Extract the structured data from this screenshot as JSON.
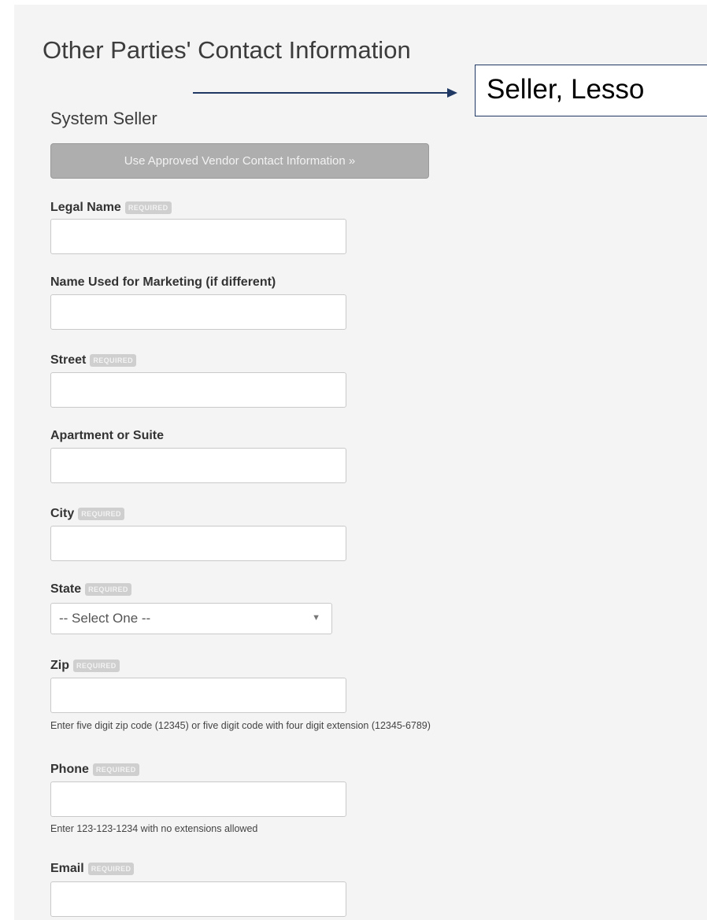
{
  "page": {
    "title": "Other Parties' Contact Information"
  },
  "section": {
    "title": "System Seller"
  },
  "annotation": {
    "text": "Seller, Lesso"
  },
  "vendor_button": {
    "label": "Use Approved Vendor Contact Information »"
  },
  "badge_text": "REQUIRED",
  "fields": {
    "legal_name": {
      "label": "Legal Name",
      "value": ""
    },
    "marketing_name": {
      "label": "Name Used for Marketing (if different)",
      "value": ""
    },
    "street": {
      "label": "Street",
      "value": ""
    },
    "apartment": {
      "label": "Apartment or Suite",
      "value": ""
    },
    "city": {
      "label": "City",
      "value": ""
    },
    "state": {
      "label": "State",
      "selected": "-- Select One --"
    },
    "zip": {
      "label": "Zip",
      "value": "",
      "help": "Enter five digit zip code (12345) or five digit code with four digit extension (12345-6789)"
    },
    "phone": {
      "label": "Phone",
      "value": "",
      "help": "Enter 123-123-1234 with no extensions allowed"
    },
    "email": {
      "label": "Email",
      "value": ""
    }
  },
  "icons": {
    "select_arrow": "▼"
  }
}
